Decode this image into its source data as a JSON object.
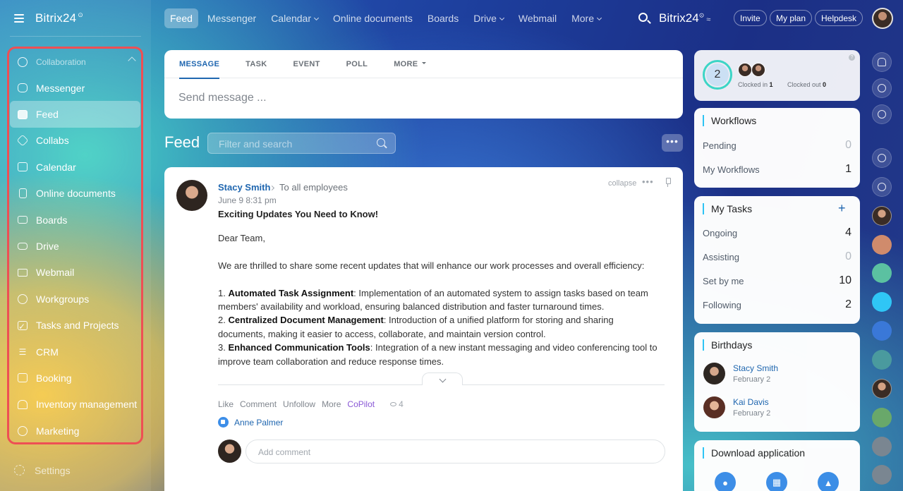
{
  "sidebar": {
    "brand": "Bitrix24",
    "group_label": "Collaboration",
    "items": [
      {
        "label": "Messenger",
        "icon": "chat-bubbles-icon"
      },
      {
        "label": "Feed",
        "icon": "feed-icon",
        "active": true
      },
      {
        "label": "Collabs",
        "icon": "hexagon-icon"
      },
      {
        "label": "Calendar",
        "icon": "calendar-icon"
      },
      {
        "label": "Online documents",
        "icon": "document-icon"
      },
      {
        "label": "Boards",
        "icon": "board-icon"
      },
      {
        "label": "Drive",
        "icon": "drive-icon"
      },
      {
        "label": "Webmail",
        "icon": "mail-icon"
      },
      {
        "label": "Workgroups",
        "icon": "users-icon"
      },
      {
        "label": "Tasks and Projects",
        "icon": "checkbox-icon"
      },
      {
        "label": "CRM",
        "icon": "funnel-icon"
      },
      {
        "label": "Booking",
        "icon": "booking-icon"
      },
      {
        "label": "Inventory management",
        "icon": "warehouse-icon"
      },
      {
        "label": "Marketing",
        "icon": "target-icon"
      }
    ],
    "settings_label": "Settings",
    "highlight_color": "#ee4f54"
  },
  "topnav": {
    "items": [
      {
        "label": "Feed",
        "active": true
      },
      {
        "label": "Messenger"
      },
      {
        "label": "Calendar",
        "dropdown": true
      },
      {
        "label": "Online documents"
      },
      {
        "label": "Boards"
      },
      {
        "label": "Drive",
        "dropdown": true
      },
      {
        "label": "Webmail"
      },
      {
        "label": "More",
        "dropdown": true
      }
    ],
    "brand": "Bitrix24",
    "invite": "Invite",
    "my_plan": "My plan",
    "helpdesk": "Helpdesk"
  },
  "composer": {
    "tabs": [
      "MESSAGE",
      "TASK",
      "EVENT",
      "POLL",
      "MORE"
    ],
    "placeholder": "Send message ..."
  },
  "feed": {
    "title": "Feed",
    "filter_placeholder": "Filter and search",
    "more_label": "•••"
  },
  "post": {
    "author": "Stacy Smith",
    "recipient": "To all employees",
    "date": "June 9 8:31 pm",
    "collapse": "collapse",
    "title": "Exciting Updates You Need to Know!",
    "greeting": "Dear Team,",
    "intro": "We are thrilled to share some recent updates that will enhance our work processes and overall efficiency:",
    "items": [
      {
        "num": "1. ",
        "heading": "Automated Task Assignment",
        "text": ": Implementation of an automated system to assign tasks based on team members' availability and workload, ensuring balanced distribution and faster turnaround times."
      },
      {
        "num": "2. ",
        "heading": "Centralized Document Management",
        "text": ": Introduction of a unified platform for storing and sharing documents, making it easier to access, collaborate, and maintain version control."
      },
      {
        "num": "3. ",
        "heading": "Enhanced Communication Tools",
        "text": ": Integration of a new instant messaging and video conferencing tool to improve team collaboration and reduce response times."
      }
    ],
    "actions": [
      "Like",
      "Comment",
      "Unfollow",
      "More"
    ],
    "copilot": "CoPilot",
    "views": "4",
    "liked_by": "Anne Palmer",
    "comment_placeholder": "Add comment"
  },
  "widgets": {
    "timeman": {
      "count": "2",
      "clocked_in_label": "Clocked in",
      "clocked_in": "1",
      "clocked_out_label": "Clocked out",
      "clocked_out": "0"
    },
    "workflows": {
      "title": "Workflows",
      "rows": [
        {
          "label": "Pending",
          "value": "0"
        },
        {
          "label": "My Workflows",
          "value": "1"
        }
      ]
    },
    "tasks": {
      "title": "My Tasks",
      "rows": [
        {
          "label": "Ongoing",
          "value": "4"
        },
        {
          "label": "Assisting",
          "value": "0"
        },
        {
          "label": "Set by me",
          "value": "10"
        },
        {
          "label": "Following",
          "value": "2"
        }
      ]
    },
    "birthdays": {
      "title": "Birthdays",
      "people": [
        {
          "name": "Stacy Smith",
          "date": "February 2"
        },
        {
          "name": "Kai Davis",
          "date": "February 2"
        }
      ]
    },
    "download": {
      "title": "Download application"
    }
  }
}
